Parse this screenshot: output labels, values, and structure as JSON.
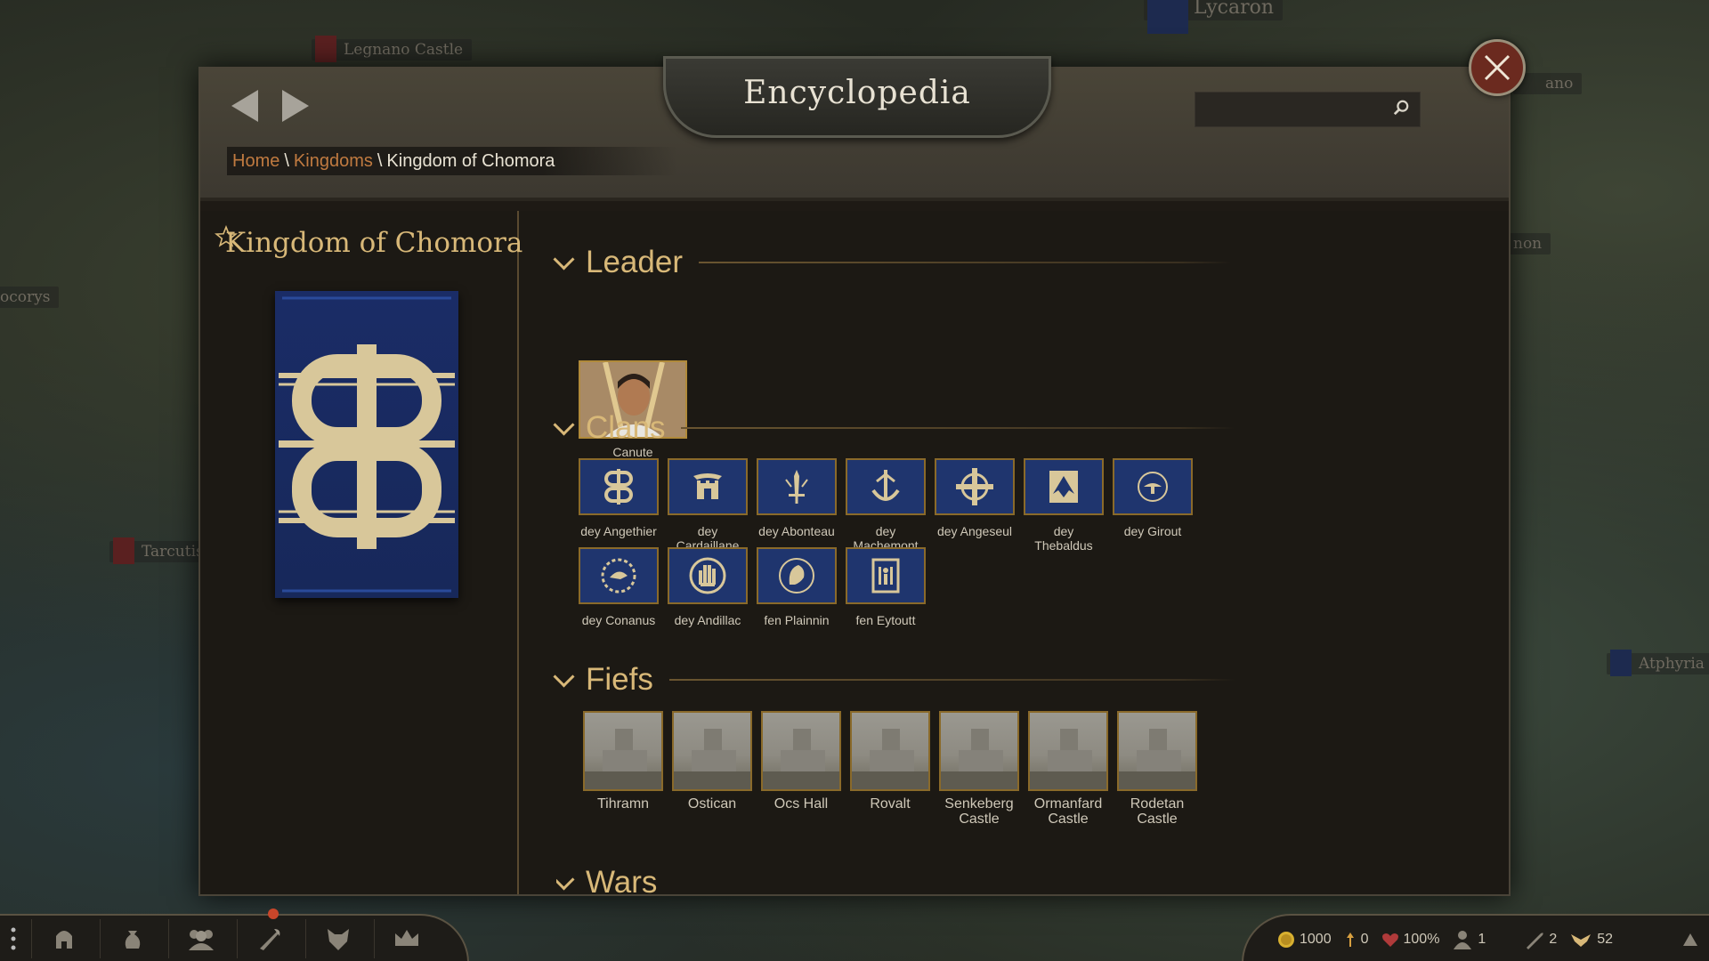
{
  "header": {
    "title": "Encyclopedia",
    "search": {
      "placeholder": "",
      "value": ""
    },
    "breadcrumb": {
      "home": "Home",
      "kingdoms": "Kingdoms",
      "sep": "\\",
      "current": "Kingdom of Chomora"
    }
  },
  "map_labels": [
    "Legnano Castle",
    "Lycaron",
    "ano",
    "ocorys",
    "Tarcutis",
    "non",
    "Atphyria"
  ],
  "kingdom": {
    "name": "Kingdom of Chomora",
    "banner_color": "#1a2c66",
    "banner_emblem_color": "#d8c79a"
  },
  "sections": {
    "leader": "Leader",
    "clans": "Clans",
    "fiefs": "Fiefs",
    "wars": "Wars"
  },
  "leader": {
    "name": "Canute"
  },
  "clans": [
    {
      "name": "dey Angethier",
      "icon": "double-ring-icon"
    },
    {
      "name": "dey Cardaillane",
      "icon": "castle-gate-icon"
    },
    {
      "name": "dey Abonteau",
      "icon": "sword-icon"
    },
    {
      "name": "dey Machemont",
      "icon": "anchor-icon"
    },
    {
      "name": "dey Angeseul",
      "icon": "cross-wheel-icon"
    },
    {
      "name": "dey Thebaldus",
      "icon": "eagle-icon"
    },
    {
      "name": "dey Girout",
      "icon": "lamp-icon"
    },
    {
      "name": "dey Conanus",
      "icon": "wreath-bird-icon"
    },
    {
      "name": "dey Andillac",
      "icon": "hand-icon"
    },
    {
      "name": "fen Plainnin",
      "icon": "lion-head-icon"
    },
    {
      "name": "fen Eytoutt",
      "icon": "tower-figure-icon"
    }
  ],
  "fiefs": [
    "Tihramn",
    "Ostican",
    "Ocs Hall",
    "Rovalt",
    "Senkeberg Castle",
    "Ormanfard Castle",
    "Rodetan Castle"
  ],
  "status": {
    "gold": "1000",
    "influence": "0",
    "health": "100%",
    "troops": "1",
    "workshops": "2",
    "food": "52"
  },
  "colors": {
    "accent_gold": "#d8b878",
    "link_orange": "#c07a40",
    "clan_bg": "#1f356e"
  }
}
